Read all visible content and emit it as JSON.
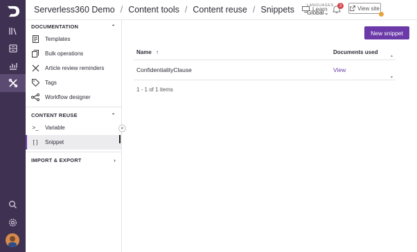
{
  "breadcrumbs": [
    "Serverless360 Demo",
    "Content tools",
    "Content reuse",
    "Snippets"
  ],
  "breadcrumb_sep": "/",
  "languages": {
    "label": "LANGUAGES",
    "value": "Global"
  },
  "learn_label": "Learn",
  "notification_count": "3",
  "view_site_label": "View site",
  "sidebar": {
    "documentation": {
      "title": "DOCUMENTATION",
      "items": [
        {
          "label": "Templates",
          "icon": "template-icon"
        },
        {
          "label": "Bulk operations",
          "icon": "bulk-icon"
        },
        {
          "label": "Article review reminders",
          "icon": "review-icon"
        },
        {
          "label": "Tags",
          "icon": "tag-icon"
        },
        {
          "label": "Workflow designer",
          "icon": "workflow-icon"
        }
      ]
    },
    "content_reuse": {
      "title": "CONTENT REUSE",
      "items": [
        {
          "label": "Variable",
          "icon": "variable-icon",
          "glyph": ">_"
        },
        {
          "label": "Snippet",
          "icon": "snippet-icon",
          "glyph": "[ ]"
        }
      ]
    },
    "import_export": {
      "title": "IMPORT & EXPORT"
    }
  },
  "main": {
    "new_button": "New snippet",
    "table": {
      "columns": [
        "Name",
        "Documents used"
      ],
      "sort_arrow": "↑",
      "rows": [
        {
          "name": "ConfidentialityClause",
          "documents_used": "View"
        }
      ]
    },
    "pager": "1 - 1 of 1 items"
  },
  "colors": {
    "rail": "#3f3152",
    "accent": "#6b3aa8",
    "badge": "#d3414a"
  }
}
